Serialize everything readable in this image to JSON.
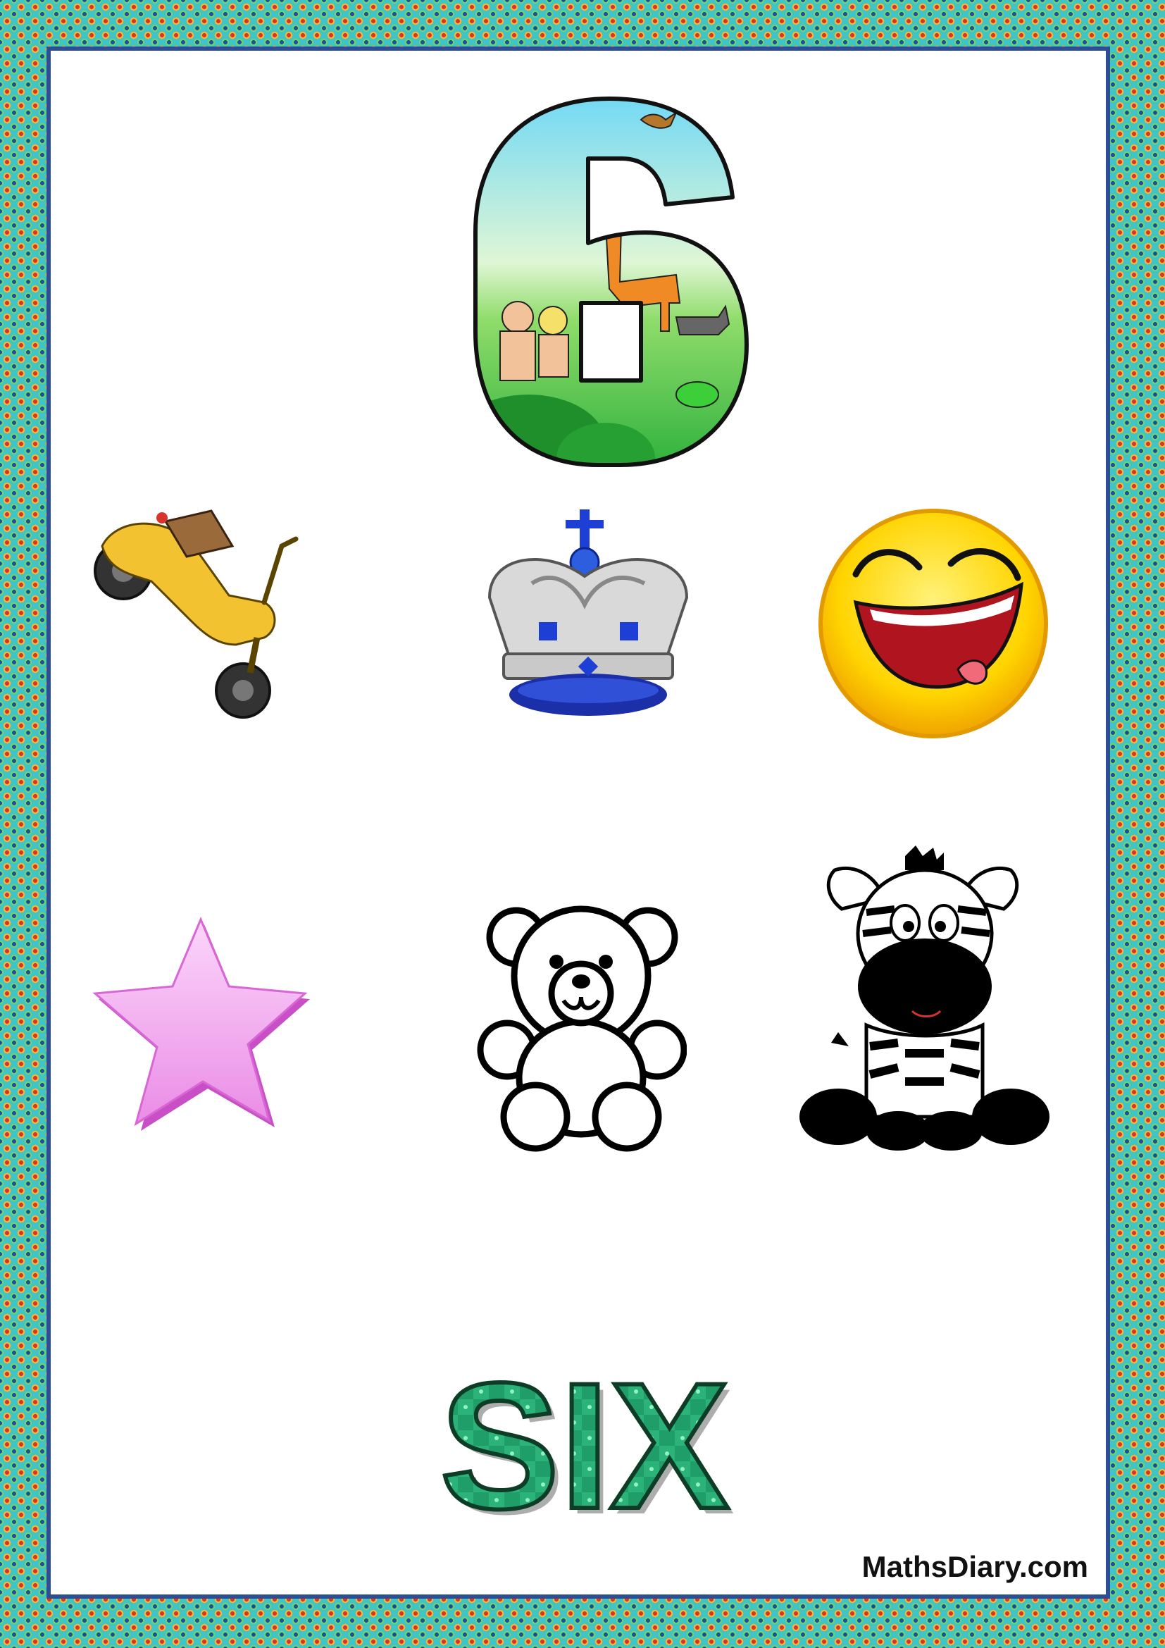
{
  "number": {
    "digit": "6",
    "word": "SIX"
  },
  "pictures": [
    {
      "name": "scooter-icon"
    },
    {
      "name": "crown-icon"
    },
    {
      "name": "laughing-face-icon"
    },
    {
      "name": "star-icon"
    },
    {
      "name": "teddy-bear-icon"
    },
    {
      "name": "zebra-icon"
    }
  ],
  "footer": {
    "site": "MathsDiary.com"
  },
  "colors": {
    "border_accent": "#3fc4c8",
    "frame_line": "#2c4f94",
    "word_fill": "#1f9e6a",
    "star_fill": "#f4a6f0",
    "smiley_fill": "#ffd400"
  }
}
